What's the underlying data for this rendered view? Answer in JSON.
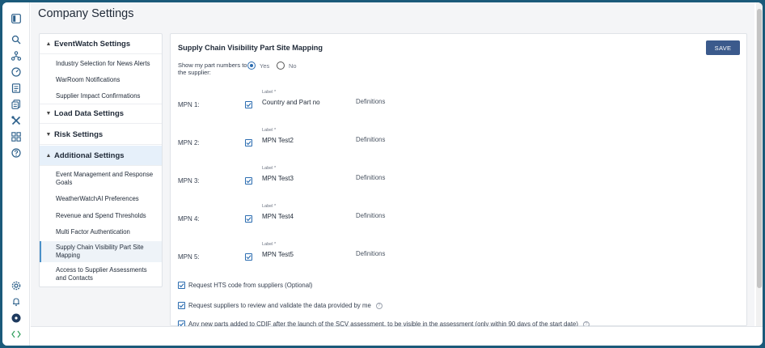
{
  "page": {
    "title": "Company Settings"
  },
  "nav": {
    "sections": [
      {
        "label": "EventWatch Settings",
        "chevron": "chevron-up"
      },
      {
        "label": "Load Data Settings",
        "chevron": "chevron-down"
      },
      {
        "label": "Risk Settings",
        "chevron": "chevron-down"
      },
      {
        "label": "Additional Settings",
        "chevron": "chevron-up"
      }
    ],
    "eventwatch_items": [
      "Industry Selection for News Alerts",
      "WarRoom Notifications",
      "Supplier Impact Confirmations"
    ],
    "additional_items": [
      "Event Management and Response Goals",
      "WeatherWatchAI Preferences",
      "Revenue and Spend Thresholds",
      "Multi Factor Authentication",
      "Supply Chain Visibility Part Site Mapping",
      "Access to Supplier Assessments and Contacts"
    ]
  },
  "content": {
    "title": "Supply Chain Visibility Part Site Mapping",
    "save_label": "SAVE",
    "show_label": "Show my part numbers to the supplier:",
    "radio_yes": "Yes",
    "radio_no": "No",
    "field_small_label": "Label *",
    "definitions": "Definitions",
    "mpn_rows": [
      {
        "label": "MPN 1:",
        "value": "Country and Part no"
      },
      {
        "label": "MPN 2:",
        "value": "MPN Test2"
      },
      {
        "label": "MPN 3:",
        "value": "MPN Test3"
      },
      {
        "label": "MPN 4:",
        "value": "MPN Test4"
      },
      {
        "label": "MPN 5:",
        "value": "MPN Test5"
      }
    ],
    "options": [
      "Request HTS code from suppliers (Optional)",
      "Request suppliers to review and validate the data provided by me",
      "Any new parts added to CDIF after the launch of the SCV assessment, to be visible in the assessment (only within 90 days of the start date)"
    ],
    "help_glyph": "?"
  },
  "colors": {
    "accent": "#2b6cb0",
    "save_button": "#3b5a8c",
    "frame": "#1b5a7a",
    "active_section": "#e6f0fa"
  },
  "icons": {
    "rail_top": [
      "sidebar-toggle-icon",
      "search-icon",
      "network-icon",
      "dashboard-gauge-icon",
      "document-icon",
      "report-icon",
      "tools-icon",
      "grid-icon",
      "help-icon"
    ],
    "rail_bottom": [
      "settings-gear-icon",
      "notification-bell-icon",
      "user-avatar-icon",
      "code-icon"
    ]
  }
}
